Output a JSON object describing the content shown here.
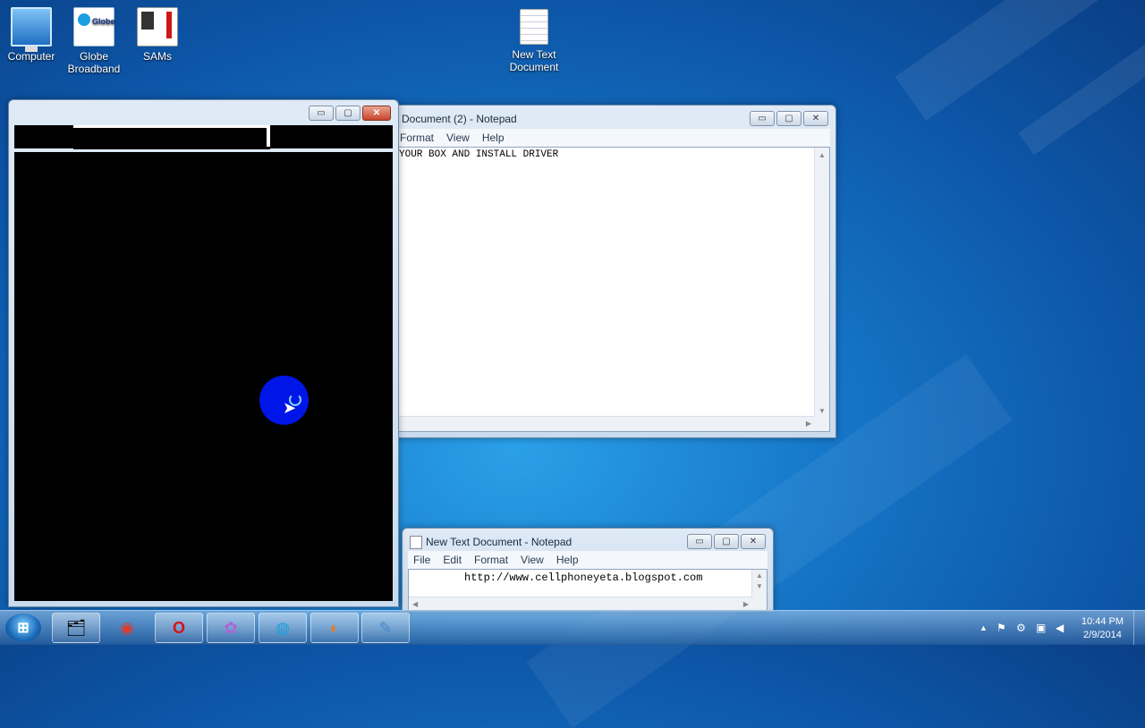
{
  "desktop": {
    "icons": [
      {
        "label": "Computer"
      },
      {
        "label": "Globe Broadband"
      },
      {
        "label": "SAMs"
      },
      {
        "label": "New Text Document"
      }
    ]
  },
  "notepad_main": {
    "title": "Document (2) - Notepad",
    "menu": [
      "Format",
      "View",
      "Help"
    ],
    "content": "YOUR BOX AND INSTALL DRIVER"
  },
  "notepad_small": {
    "title": "New Text Document - Notepad",
    "menu": [
      "File",
      "Edit",
      "Format",
      "View",
      "Help"
    ],
    "content": "http://www.cellphoneyeta.blogspot.com"
  },
  "window_buttons": {
    "minimize": "▭",
    "maximize": "▢",
    "close": "✕"
  },
  "taskbar": {
    "start_icon": "windows-logo-icon",
    "buttons": [
      {
        "name": "explorer",
        "glyph": "🗂"
      },
      {
        "name": "chrome",
        "glyph": "◉"
      },
      {
        "name": "opera",
        "glyph": "O"
      },
      {
        "name": "app-purple",
        "glyph": "✿"
      },
      {
        "name": "globe-broadband",
        "glyph": "◍"
      },
      {
        "name": "firefox",
        "glyph": "◐"
      },
      {
        "name": "notepad",
        "glyph": "✎"
      }
    ],
    "clock_time": "10:44 PM",
    "clock_date": "2/9/2014"
  }
}
